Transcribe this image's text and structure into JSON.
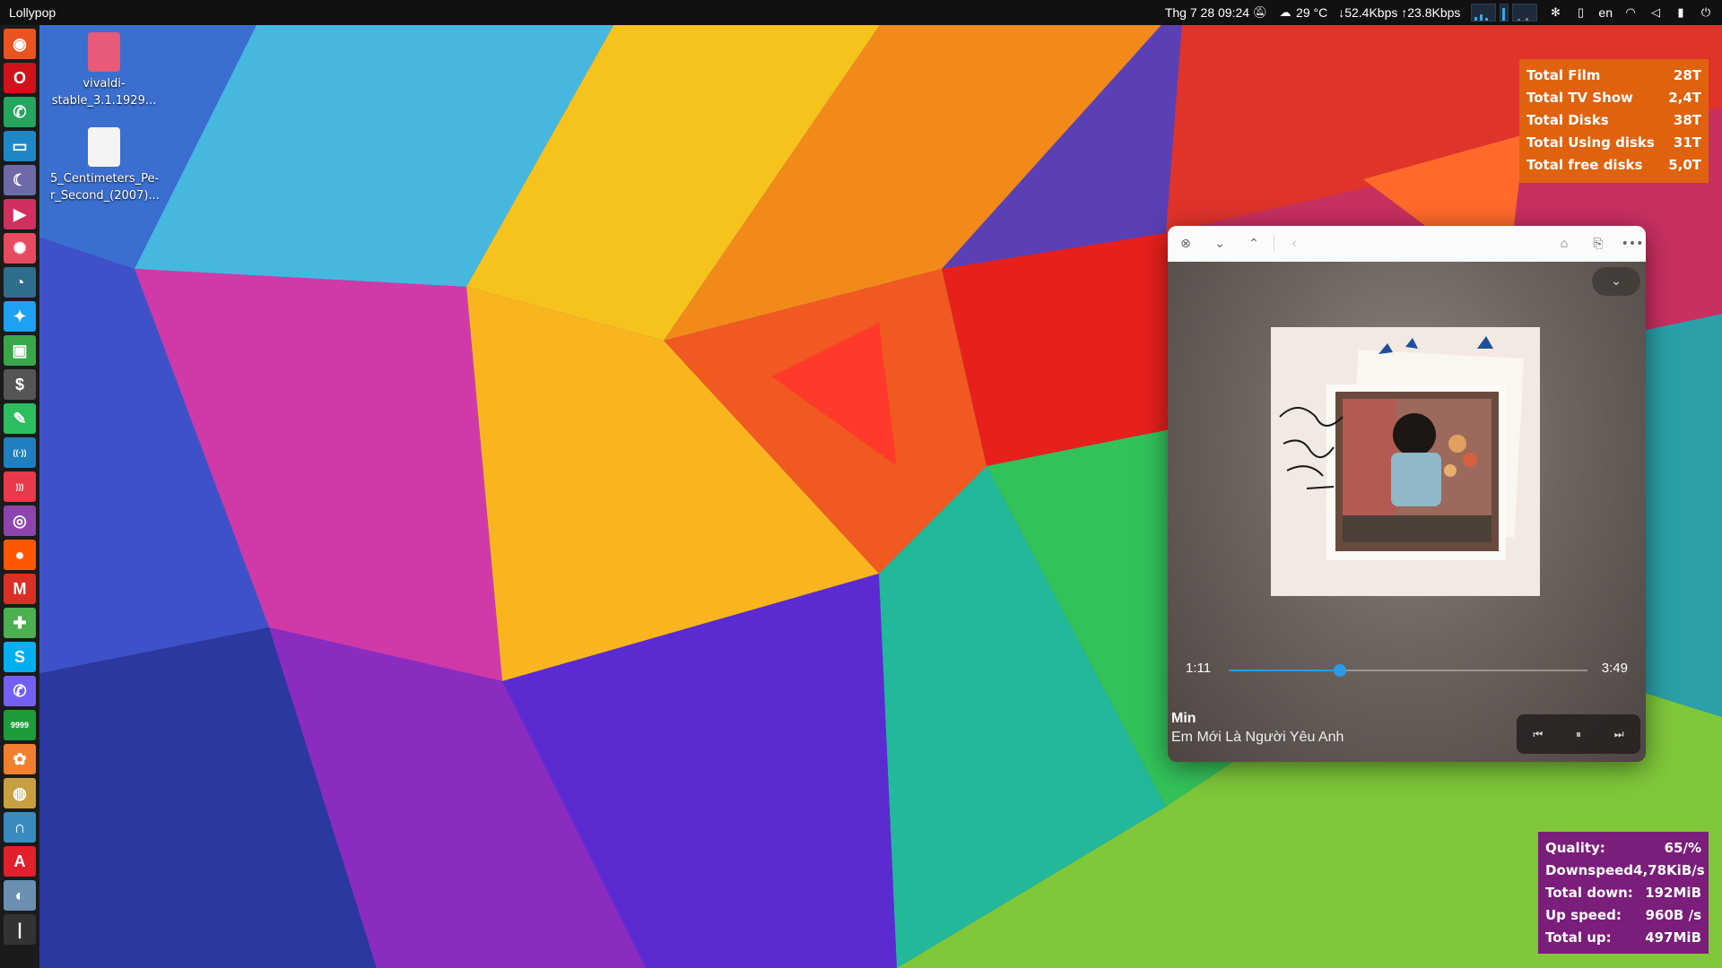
{
  "top_panel": {
    "app_name": "Lollypop",
    "datetime": "Thg 7 28  09:24",
    "weather": "29 °C",
    "network": "↓52.4Kbps ↑23.8Kbps",
    "language": "en",
    "icons": [
      "notifications-off-icon",
      "cloud-icon",
      "cpu-graph-icon",
      "fan-icon",
      "clipboard-icon",
      "wifi-icon",
      "volume-icon",
      "battery-icon",
      "power-icon"
    ]
  },
  "launcher": {
    "items": [
      {
        "name": "ubuntu-icon",
        "glyph": "◉",
        "color": "#e95420"
      },
      {
        "name": "opera-icon",
        "glyph": "O",
        "color": "#d0121b"
      },
      {
        "name": "whatsapp-icon",
        "glyph": "✆",
        "color": "#25a55f"
      },
      {
        "name": "files-icon",
        "glyph": "▭",
        "color": "#1e88c7"
      },
      {
        "name": "moon-app-icon",
        "glyph": "☾",
        "color": "#6e6aa8"
      },
      {
        "name": "video-player-icon",
        "glyph": "▶",
        "color": "#d03060"
      },
      {
        "name": "pinwheel-icon",
        "glyph": "✺",
        "color": "#e84a5f"
      },
      {
        "name": "speedometer-icon",
        "glyph": "◔",
        "color": "#2f6d8c"
      },
      {
        "name": "twitter-icon",
        "glyph": "✦",
        "color": "#1da1f2"
      },
      {
        "name": "media-center-icon",
        "glyph": "▣",
        "color": "#3aa64a"
      },
      {
        "name": "terminal-icon",
        "glyph": "$",
        "color": "#555555"
      },
      {
        "name": "evernote-icon",
        "glyph": "✎",
        "color": "#2dbe60"
      },
      {
        "name": "radio-icon",
        "glyph": "((·))",
        "color": "#1f7fbf"
      },
      {
        "name": "rss-icon",
        "glyph": ")))",
        "color": "#e83a4a"
      },
      {
        "name": "podcast-icon",
        "glyph": "◎",
        "color": "#8e44ad"
      },
      {
        "name": "reddit-icon",
        "glyph": "●",
        "color": "#ff5700"
      },
      {
        "name": "gmail-icon",
        "glyph": "M",
        "color": "#d93025"
      },
      {
        "name": "game-controller-icon",
        "glyph": "✚",
        "color": "#4caf50"
      },
      {
        "name": "skype-icon",
        "glyph": "S",
        "color": "#00aff0"
      },
      {
        "name": "viber-icon",
        "glyph": "✆",
        "color": "#7360f2"
      },
      {
        "name": "counter-icon",
        "glyph": "9999",
        "color": "#1e9b3b"
      },
      {
        "name": "chat-app-icon",
        "glyph": "✿",
        "color": "#f08030"
      },
      {
        "name": "disk-utility-icon",
        "glyph": "◍",
        "color": "#c8a040"
      },
      {
        "name": "headphones-icon",
        "glyph": "∩",
        "color": "#3a8cc0"
      },
      {
        "name": "adobe-icon",
        "glyph": "A",
        "color": "#e0202a"
      },
      {
        "name": "gamepad-icon",
        "glyph": "◐",
        "color": "#6a8fb0"
      },
      {
        "name": "microphone-icon",
        "glyph": "|",
        "color": "#333333"
      }
    ]
  },
  "desktop_icons": [
    {
      "label_line1": "vivaldi-",
      "label_line2": "stable_3.1.1929...",
      "color": "#e85a78"
    },
    {
      "label_line1": "5_Centimeters_Pe-",
      "label_line2": "r_Second_(2007)...",
      "color": "#f4f4f4"
    }
  ],
  "media_stats": {
    "bg_color": "#e0620e",
    "rows": [
      {
        "label": "Total Film",
        "value": "28T"
      },
      {
        "label": "Total TV Show",
        "value": "2,4T"
      },
      {
        "label": "Total Disks",
        "value": "38T"
      },
      {
        "label": "Total Using disks",
        "value": "31T"
      },
      {
        "label": "Total free disks",
        "value": "5,0T"
      }
    ]
  },
  "net_stats": {
    "bg_color": "#7b1d7a",
    "rows": [
      {
        "label": "Quality:",
        "value": "65/%"
      },
      {
        "label": "Downspeed",
        "value": "4,78KiB/s"
      },
      {
        "label": "Total down:",
        "value": "192MiB"
      },
      {
        "label": "Up speed:",
        "value": "960B  /s"
      },
      {
        "label": "Total up:",
        "value": "497MiB"
      }
    ]
  },
  "player": {
    "titlebar_icons": [
      "close-icon",
      "chevron-down-icon",
      "chevron-up-icon",
      "back-icon",
      "home-icon",
      "share-icon",
      "more-icon"
    ],
    "time_elapsed": "1:11",
    "time_total": "3:49",
    "progress": 0.31,
    "artist": "Min",
    "title": "Em Mới Là Người Yêu Anh",
    "accent": "#2b9ae8"
  }
}
